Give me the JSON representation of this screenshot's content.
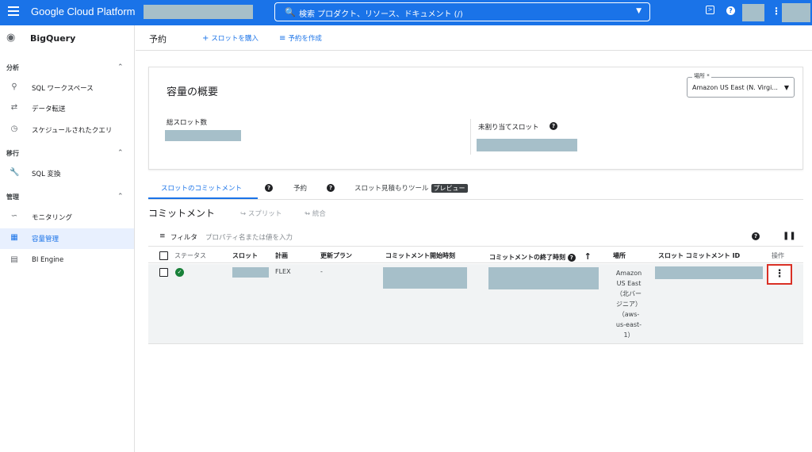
{
  "topbar": {
    "app_title": "Google Cloud Platform",
    "search_placeholder": "検索 プロダクト、リソース、ドキュメント (/)",
    "icons": [
      "menu-icon",
      "search-icon",
      "chevron-down-icon",
      "terminal-icon",
      "help-icon",
      "more-vert-icon"
    ]
  },
  "sidebar": {
    "product": "BigQuery",
    "sections": [
      {
        "label": "分析",
        "items": [
          "SQL ワークスペース",
          "データ転送",
          "スケジュールされたクエリ"
        ]
      },
      {
        "label": "移行",
        "items": [
          "SQL 変換"
        ]
      },
      {
        "label": "管理",
        "items": [
          "モニタリング",
          "容量管理",
          "BI Engine"
        ]
      }
    ],
    "active_item": "容量管理"
  },
  "header": {
    "title": "予約",
    "buy_slots": "スロットを購入",
    "create_reservation": "予約を作成"
  },
  "overview": {
    "title": "容量の概要",
    "location_label": "場所 *",
    "location_value": "Amazon US East (N. Virgi...",
    "total_slots_label": "総スロット数",
    "unassigned_slots_label": "未割り当てスロット"
  },
  "tabs": {
    "commitments": "スロットのコミットメント",
    "reservations": "予約",
    "estimator": "スロット見積もりツール",
    "preview_badge": "プレビュー"
  },
  "commitments": {
    "title": "コミットメント",
    "split": "スプリット",
    "merge": "統合",
    "filter_label": "フィルタ",
    "filter_placeholder": "プロパティ名または値を入力",
    "columns": {
      "status": "ステータス",
      "slots": "スロット",
      "plan": "計画",
      "renewal_plan": "更新プラン",
      "start_time": "コミットメント開始時刻",
      "end_time": "コミットメントの終了時刻",
      "location": "場所",
      "commitment_id": "スロット コミットメント ID",
      "actions": "操作"
    },
    "rows": [
      {
        "plan": "FLEX",
        "renewal_plan": "-",
        "location_lines": [
          "Amazon",
          "US East",
          "（北バー",
          "ジニア）",
          "（aws-",
          "us-east-",
          "1）"
        ]
      }
    ]
  },
  "colors": {
    "accent": "#1a73e8",
    "status_ok": "#188038",
    "highlight": "#d93025"
  }
}
